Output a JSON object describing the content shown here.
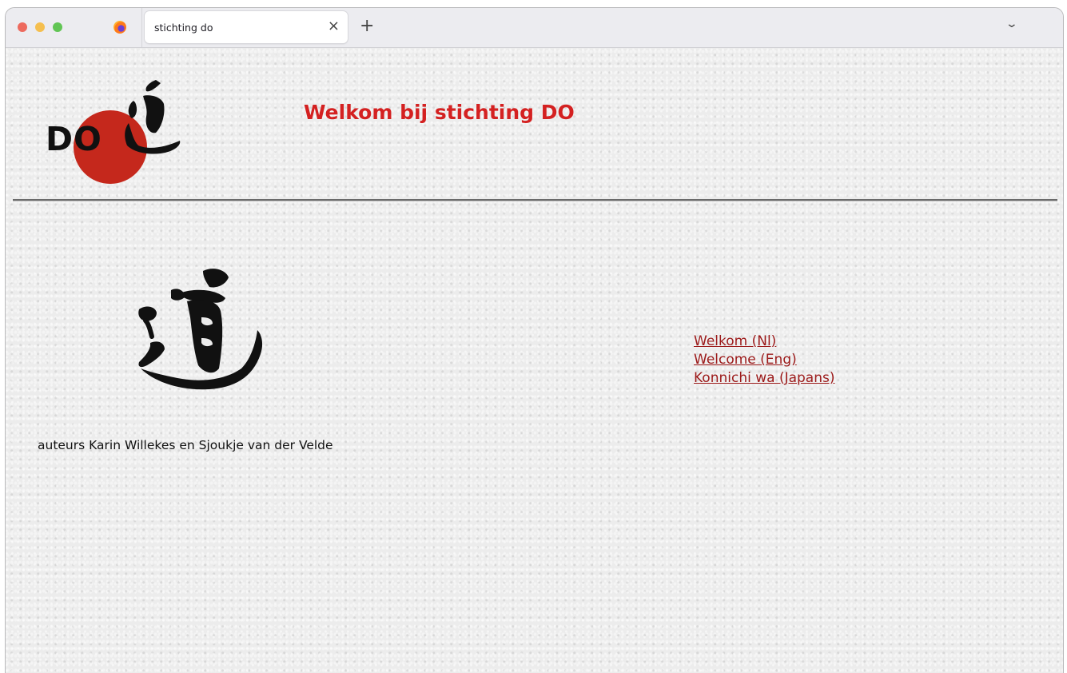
{
  "browser": {
    "tab_title": "stichting do",
    "close_tab_glyph": "×",
    "new_tab_glyph": "+",
    "tab_list_glyph": "⌄"
  },
  "page": {
    "logo_text": "DO",
    "headline": "Welkom bij stichting DO",
    "authors": "auteurs Karin Willekes en Sjoukje van der Velde",
    "links": [
      {
        "label": "Welkom (Nl)"
      },
      {
        "label": "Welcome (Eng)"
      },
      {
        "label": "Konnichi wa (Japans)"
      }
    ]
  },
  "colors": {
    "headline": "#d42121",
    "logo_sun": "#c5281c",
    "link": "#9c1a1a"
  },
  "icons": [
    "firefox-icon",
    "close-icon",
    "plus-icon",
    "chevron-down-icon",
    "do-kanji-calligraphy"
  ]
}
